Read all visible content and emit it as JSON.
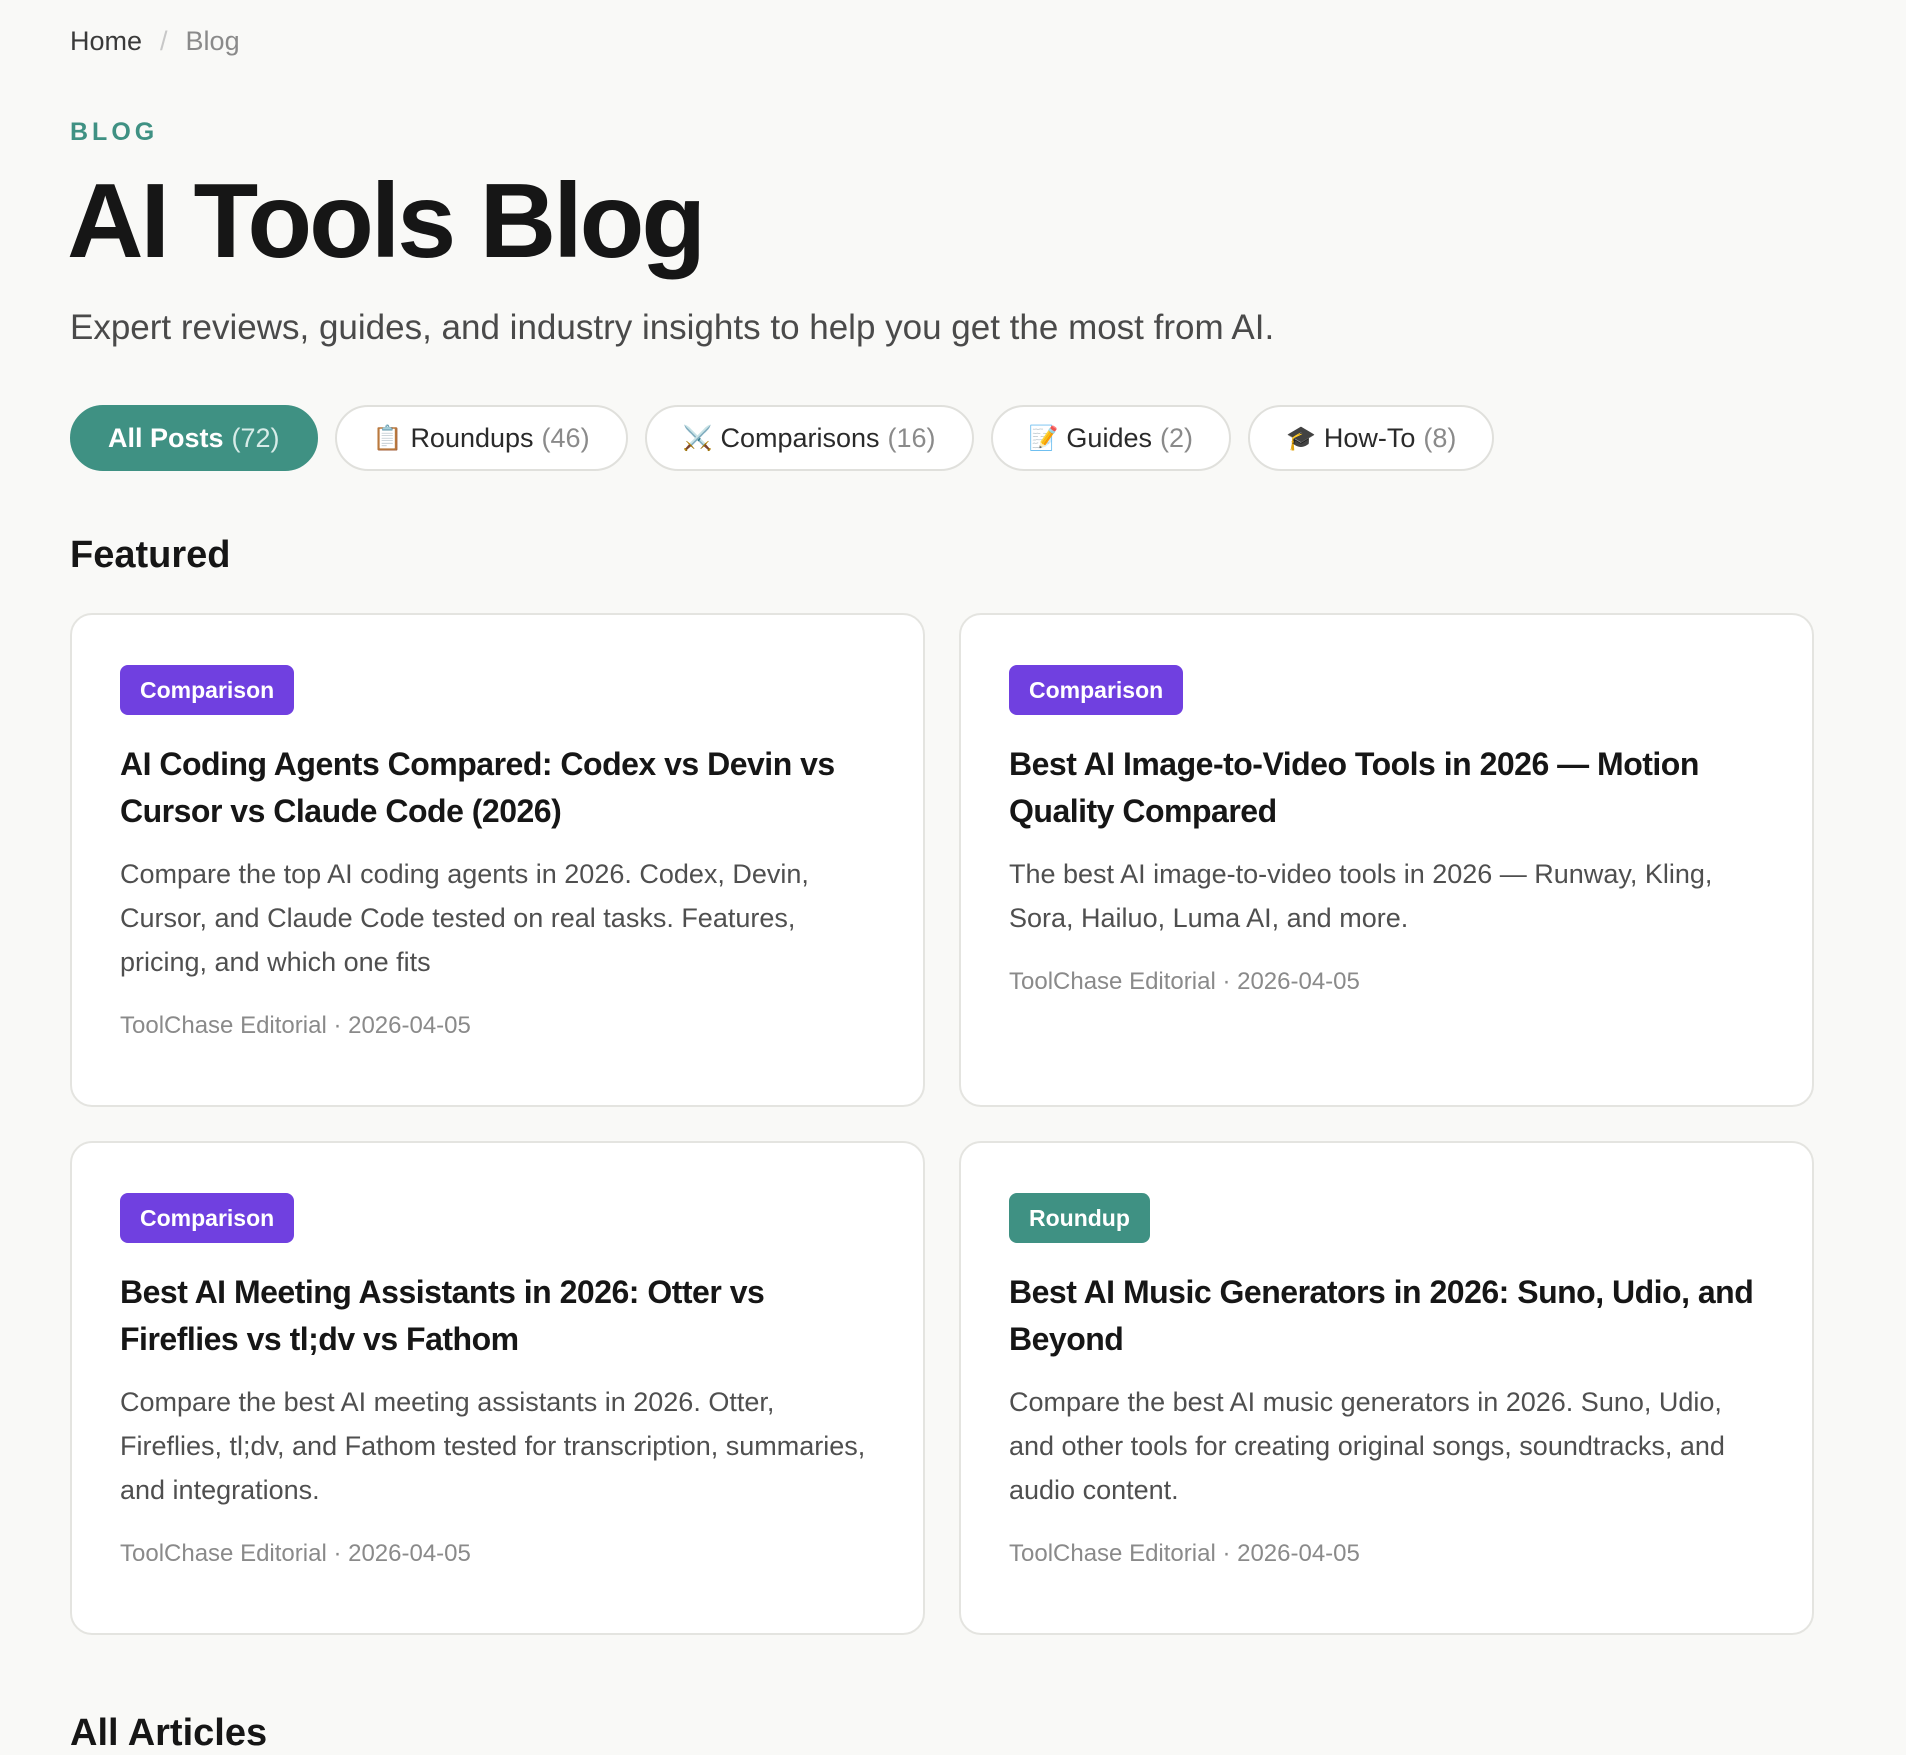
{
  "breadcrumb": {
    "home": "Home",
    "separator": "/",
    "current": "Blog"
  },
  "header": {
    "eyebrow": "BLOG",
    "title": "AI Tools Blog",
    "subtitle": "Expert reviews, guides, and industry insights to help you get the most from AI."
  },
  "filters": [
    {
      "icon": "",
      "label": "All Posts",
      "count": "(72)",
      "active": true
    },
    {
      "icon": "📋",
      "label": "Roundups",
      "count": "(46)",
      "active": false
    },
    {
      "icon": "⚔️",
      "label": "Comparisons",
      "count": "(16)",
      "active": false
    },
    {
      "icon": "📝",
      "label": "Guides",
      "count": "(2)",
      "active": false
    },
    {
      "icon": "🎓",
      "label": "How-To",
      "count": "(8)",
      "active": false
    }
  ],
  "featured": {
    "heading": "Featured",
    "cards": [
      {
        "badge": "Comparison",
        "title": "AI Coding Agents Compared: Codex vs Devin vs Cursor vs Claude Code (2026)",
        "excerpt": "Compare the top AI coding agents in 2026. Codex, Devin, Cursor, and Claude Code tested on real tasks. Features, pricing, and which one fits",
        "meta": "ToolChase Editorial · 2026-04-05"
      },
      {
        "badge": "Comparison",
        "title": "Best AI Image-to-Video Tools in 2026 — Motion Quality Compared",
        "excerpt": "The best AI image-to-video tools in 2026 — Runway, Kling, Sora, Hailuo, Luma AI, and more.",
        "meta": "ToolChase Editorial · 2026-04-05"
      },
      {
        "badge": "Comparison",
        "title": "Best AI Meeting Assistants in 2026: Otter vs Fireflies vs tl;dv vs Fathom",
        "excerpt": "Compare the best AI meeting assistants in 2026. Otter, Fireflies, tl;dv, and Fathom tested for transcription, summaries, and integrations.",
        "meta": "ToolChase Editorial · 2026-04-05"
      },
      {
        "badge": "Roundup",
        "title": "Best AI Music Generators in 2026: Suno, Udio, and Beyond",
        "excerpt": "Compare the best AI music generators in 2026. Suno, Udio, and other tools for creating original songs, soundtracks, and audio content.",
        "meta": "ToolChase Editorial · 2026-04-05"
      }
    ]
  },
  "all_articles": {
    "heading": "All Articles"
  },
  "colors": {
    "accent": "#3f9183",
    "comparison_badge": "#7040e0",
    "roundup_badge": "#3f9183",
    "background": "#f9f9f7"
  }
}
